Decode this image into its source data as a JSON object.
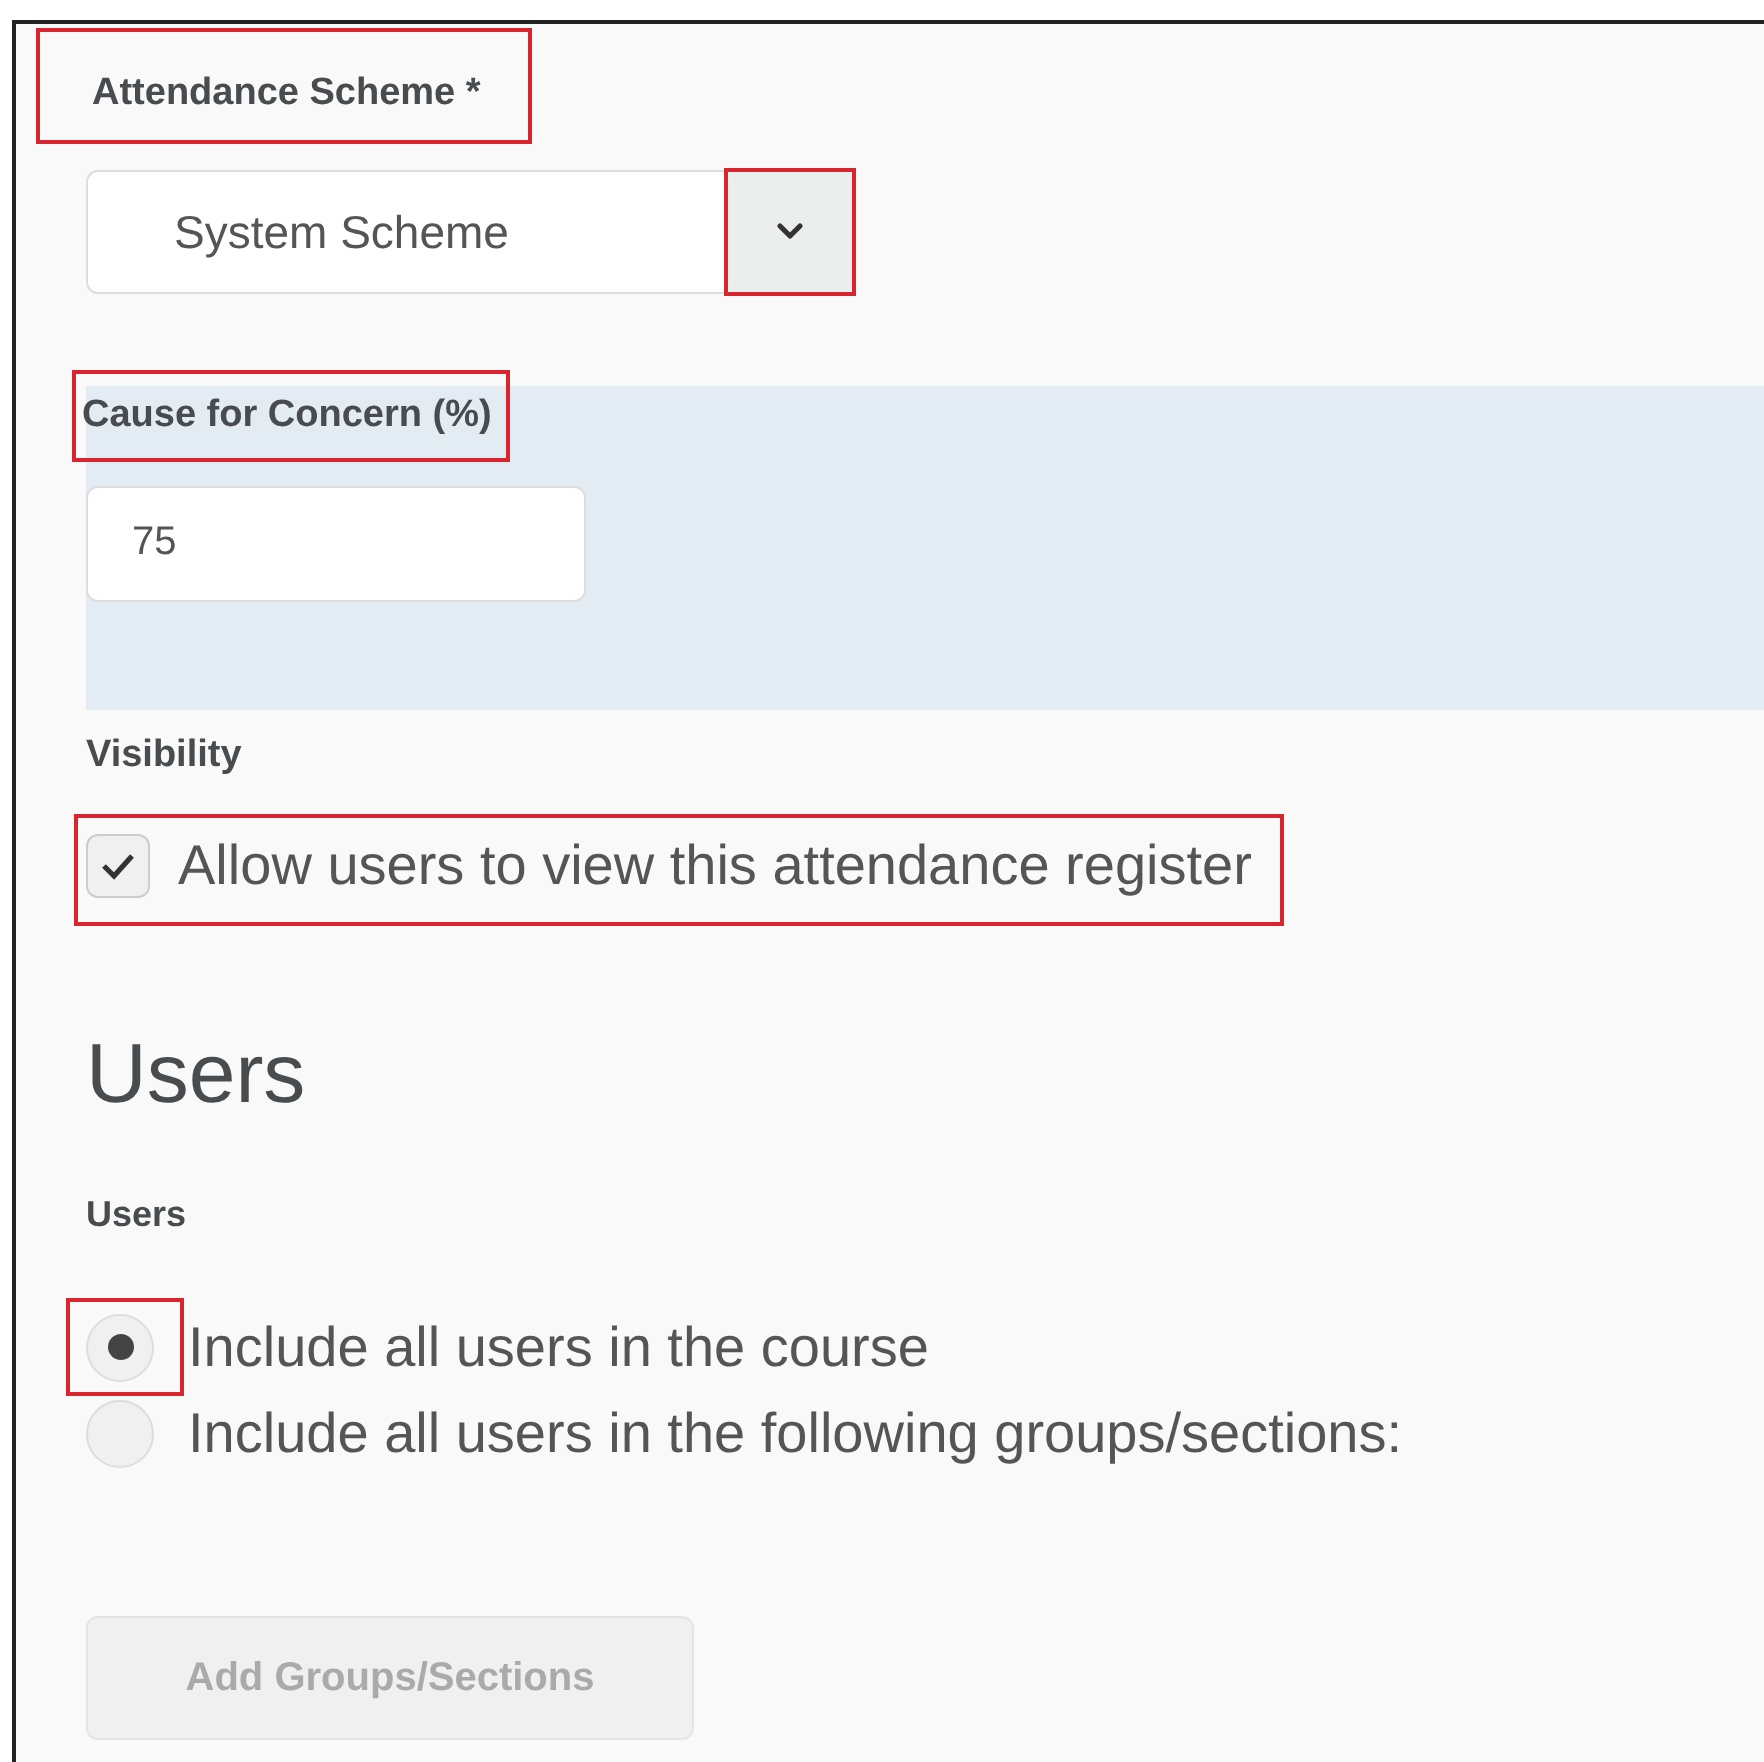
{
  "scheme": {
    "label": "Attendance Scheme *",
    "label_highlighted": true,
    "value": "System Scheme",
    "toggle_highlighted": true
  },
  "concern": {
    "label": "Cause for Concern (%)",
    "label_highlighted": true,
    "value": "75"
  },
  "visibility": {
    "label": "Visibility",
    "checkbox": {
      "label": "Allow users to view this attendance register",
      "checked": true,
      "highlighted": true
    }
  },
  "users_heading": "Users",
  "users": {
    "label": "Users",
    "options": [
      {
        "label": "Include all users in the course",
        "selected": true,
        "highlighted": true
      },
      {
        "label": "Include all users in the following groups/sections:",
        "selected": false,
        "highlighted": false
      }
    ]
  },
  "add_button": {
    "label": "Add Groups/Sections",
    "disabled": true
  }
}
